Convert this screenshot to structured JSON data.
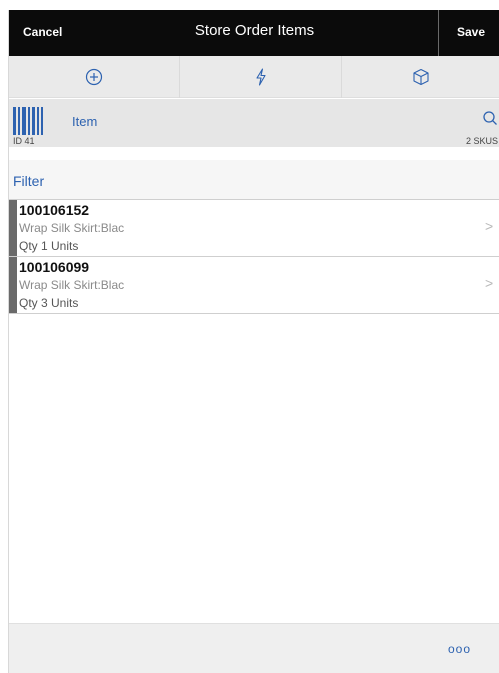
{
  "header": {
    "cancel_label": "Cancel",
    "title": "Store Order Items",
    "save_label": "Save"
  },
  "toolbar": {
    "buttons": [
      {
        "icon": "add-circle-icon"
      },
      {
        "icon": "lightning-icon"
      },
      {
        "icon": "box-icon"
      }
    ]
  },
  "scan": {
    "label": "Item",
    "id_text": "ID 41",
    "skus_text": "2 SKUS"
  },
  "filter": {
    "label": "Filter"
  },
  "items": [
    {
      "number": "100106152",
      "description": "Wrap Silk Skirt:Blac",
      "quantity": "Qty 1 Units"
    },
    {
      "number": "100106099",
      "description": "Wrap Silk Skirt:Blac",
      "quantity": "Qty 3 Units"
    }
  ],
  "footer": {
    "more_label": "ooo"
  },
  "colors": {
    "accent": "#2d62b0",
    "header_bg": "#0b0b0b",
    "toolbar_bg": "#eaeaea"
  }
}
